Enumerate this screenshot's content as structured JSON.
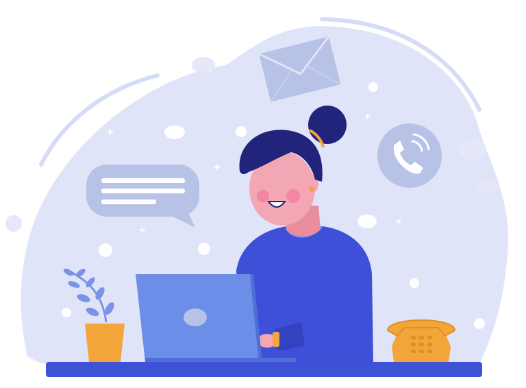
{
  "colors": {
    "background": "#ffffff",
    "blob": "#dfe4f8",
    "blob_outline": "#d5dcf6",
    "icon_muted": "#b7c2e6",
    "dots": "#ffffff",
    "desk": "#3f51d6",
    "sweater": "#3e4fd8",
    "sweater_shadow": "#3343c0",
    "skin": "#f3a6b4",
    "skin_shadow": "#e98d9f",
    "cheek": "#f27a99",
    "hair": "#22237a",
    "gold": "#f4a53a",
    "laptop": "#6d8ee8",
    "laptop_dark": "#4e6fd8",
    "plant_leaf": "#7b93e6",
    "pot": "#f4a53a",
    "phone": "#f4a53a",
    "phone_dark": "#e08f22"
  }
}
